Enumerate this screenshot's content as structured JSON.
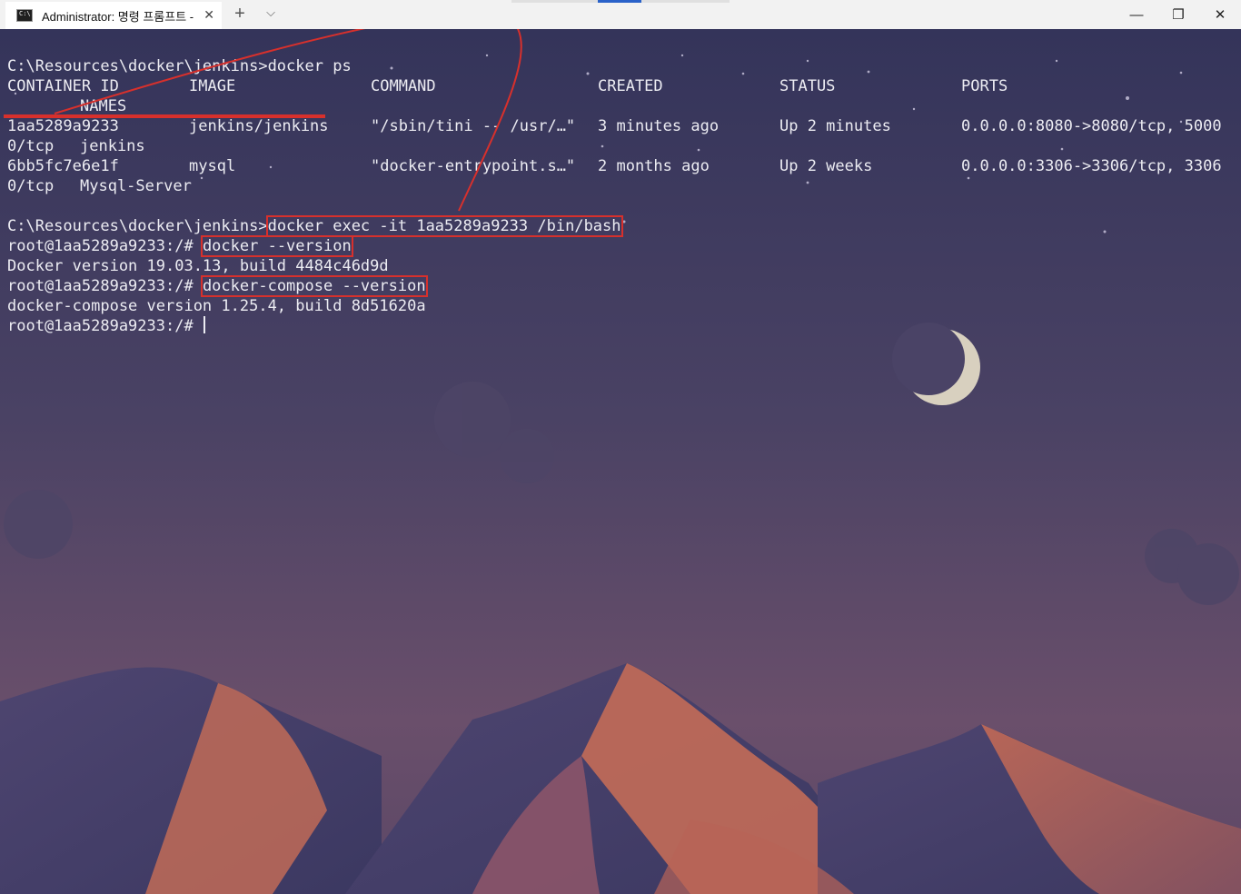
{
  "window": {
    "tab_title": "Administrator: 명령 프롬프트 - ",
    "new_tab": "+",
    "dropdown": "⌵",
    "close_tab": "✕",
    "minimize": "—",
    "restore": "❐",
    "close": "✕",
    "loading_progress": 0.2
  },
  "terminal": {
    "line1": "C:\\Resources\\docker\\jenkins>docker ps",
    "headers": [
      "CONTAINER ID",
      "IMAGE",
      "COMMAND",
      "CREATED",
      "STATUS",
      "PORTS"
    ],
    "header_names": "NAMES",
    "rows": [
      {
        "id": "1aa5289a9233",
        "image": "jenkins/jenkins",
        "command": "\"/sbin/tini -- /usr/…\"",
        "created": "3 minutes ago",
        "status": "Up 2 minutes",
        "ports": "0.0.0.0:8080->8080/tcp, 5000",
        "cont_ports": "0/tcp",
        "name": "jenkins"
      },
      {
        "id": "6bb5fc7e6e1f",
        "image": "mysql",
        "command": "\"docker-entrypoint.s…\"",
        "created": "2 months ago",
        "status": "Up 2 weeks",
        "ports": "0.0.0.0:3306->3306/tcp, 3306",
        "cont_ports": "0/tcp",
        "name": "Mysql-Server"
      }
    ],
    "prompt_path": "C:\\Resources\\docker\\jenkins>",
    "exec_cmd": "docker exec -it 1aa5289a9233 /bin/bash",
    "root_prompt": "root@1aa5289a9233:/# ",
    "cmd_docker_version": "docker --version",
    "out_docker_version": "Docker version 19.03.13, build 4484c46d9d",
    "cmd_compose_version": "docker-compose --version",
    "out_compose_version": "docker-compose version 1.25.4, build 8d51620a"
  },
  "colors": {
    "terminal_text": "#ececf2",
    "highlight": "#d7302c",
    "sky_top": "#35355a",
    "sky_bottom": "#6a4f6a",
    "dune_orange": "#c96b56"
  }
}
